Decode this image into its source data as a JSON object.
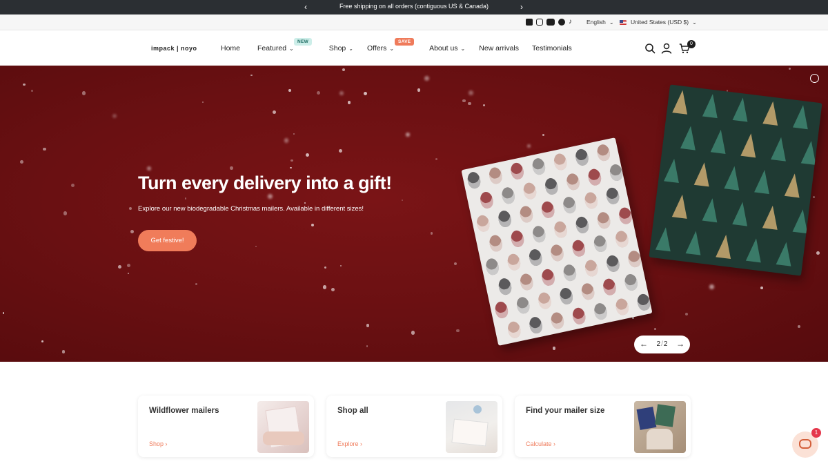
{
  "announcement": {
    "text": "Free shipping on all orders (contiguous US & Canada)",
    "prev_icon": "‹",
    "next_icon": "›"
  },
  "utility": {
    "social_icons": [
      "facebook-icon",
      "instagram-icon",
      "youtube-icon",
      "pinterest-icon",
      "tiktok-icon"
    ],
    "language": "English",
    "country": "United States (USD $)"
  },
  "header": {
    "logo": "impack | noyo",
    "nav": [
      {
        "label": "Home"
      },
      {
        "label": "Featured",
        "badge": "NEW"
      },
      {
        "label": "Shop"
      },
      {
        "label": "Offers",
        "badge": "SAVE"
      },
      {
        "label": "About us"
      },
      {
        "label": "New arrivals"
      },
      {
        "label": "Testimonials"
      }
    ],
    "cart_count": "0"
  },
  "hero": {
    "title": "Turn every delivery into a gift!",
    "subtitle": "Explore our new biodegradable Christmas mailers. Available in different sizes!",
    "cta": "Get festive!",
    "slide_current": "2",
    "slide_sep": "/",
    "slide_total": "2",
    "colors": {
      "background": "#6a1012",
      "button": "#f07c5a"
    }
  },
  "cards": [
    {
      "title": "Wildflower mailers",
      "link": "Shop"
    },
    {
      "title": "Shop all",
      "link": "Explore"
    },
    {
      "title": "Find your mailer size",
      "link": "Calculate"
    }
  ],
  "chat": {
    "badge": "1"
  }
}
